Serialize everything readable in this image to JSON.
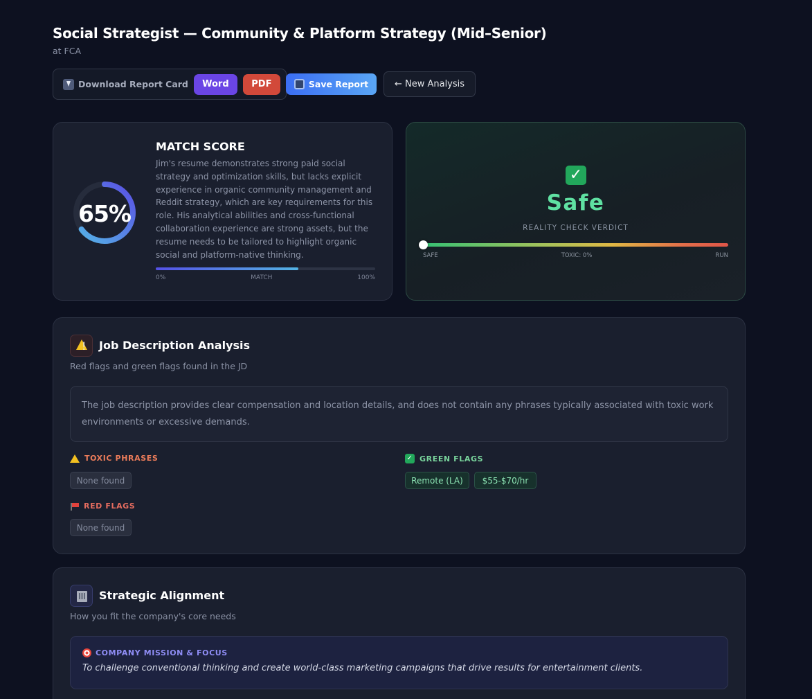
{
  "header": {
    "title": "Social Strategist — Community & Platform Strategy (Mid–Senior)",
    "company": "at FCA"
  },
  "toolbar": {
    "download_label": "Download Report Card",
    "word_label": "Word",
    "pdf_label": "PDF",
    "save_label": "Save Report",
    "new_analysis_label": "← New Analysis"
  },
  "match": {
    "percent_text": "65%",
    "percent_value": 65,
    "title": "MATCH SCORE",
    "description": "Jim's resume demonstrates strong paid social strategy and optimization skills, but lacks explicit experience in organic community management and Reddit strategy, which are key requirements for this role. His analytical abilities and cross-functional collaboration experience are strong assets, but the resume needs to be tailored to highlight organic social and platform-native thinking.",
    "bar_min": "0%",
    "bar_label": "MATCH",
    "bar_max": "100%"
  },
  "verdict": {
    "word": "Safe",
    "caption": "REALITY CHECK VERDICT",
    "toxic_value": 0,
    "label_left": "SAFE",
    "label_mid": "TOXIC: 0%",
    "label_right": "RUN"
  },
  "jd_analysis": {
    "title": "Job Description Analysis",
    "subtitle": "Red flags and green flags found in the JD",
    "summary": "The job description provides clear compensation and location details, and does not contain any phrases typically associated with toxic work environments or excessive demands.",
    "toxic_heading": "TOXIC PHRASES",
    "toxic_items": [
      "None found"
    ],
    "red_heading": "RED FLAGS",
    "red_items": [
      "None found"
    ],
    "green_heading": "GREEN FLAGS",
    "green_items": [
      "Remote (LA)",
      "$55-$70/hr"
    ]
  },
  "alignment": {
    "title": "Strategic Alignment",
    "subtitle": "How you fit the company's core needs",
    "mission_heading": "COMPANY MISSION & FOCUS",
    "mission_text": "To challenge conventional thinking and create world-class marketing campaigns that drive results for entertainment clients."
  },
  "colors": {
    "background": "#0d1120",
    "card": "#1a1f2e",
    "accent_purple": "#6a45e5",
    "accent_red": "#d2493a",
    "accent_blue": "#3b6ef3",
    "safe_green": "#5fe1a2"
  },
  "icons": {
    "download": "download-icon",
    "save": "floppy-disk-icon",
    "verdict": "check-mark-icon",
    "jd": "warning-icon",
    "red_flags": "red-flag-icon",
    "green_flags": "check-mark-icon",
    "alignment": "building-icon",
    "mission": "target-icon"
  }
}
